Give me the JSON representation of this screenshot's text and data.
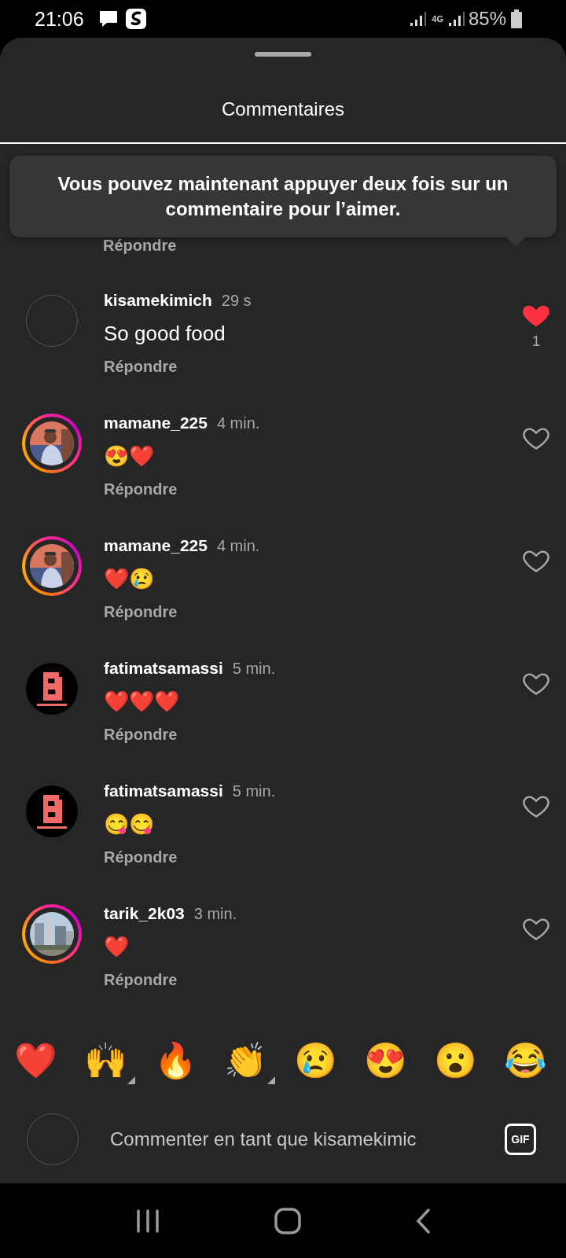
{
  "status_bar": {
    "time": "21:06",
    "network": "4G",
    "battery": "85%"
  },
  "sheet": {
    "title": "Commentaires"
  },
  "tooltip": {
    "text": "Vous pouvez maintenant appuyer deux fois sur un commentaire pour l’aimer."
  },
  "partial_reply": "Répondre",
  "comments": [
    {
      "username": "kisamekimich",
      "time": "29 s",
      "text": "So good food",
      "reply": "Répondre",
      "avatar": {
        "kind": "empty",
        "story_ring": false
      },
      "liked": true,
      "like_count": "1"
    },
    {
      "username": "mamane_225",
      "time": "4 min.",
      "text": "😍❤️",
      "reply": "Répondre",
      "avatar": {
        "kind": "picture",
        "story_ring": true
      },
      "liked": false
    },
    {
      "username": "mamane_225",
      "time": "4 min.",
      "text": "❤️😢",
      "reply": "Répondre",
      "avatar": {
        "kind": "picture",
        "story_ring": true
      },
      "liked": false
    },
    {
      "username": "fatimatsamassi",
      "time": "5 min.",
      "text": "❤️❤️❤️",
      "reply": "Répondre",
      "avatar": {
        "kind": "picture",
        "story_ring": false
      },
      "liked": false
    },
    {
      "username": "fatimatsamassi",
      "time": "5 min.",
      "text": "😋😋",
      "reply": "Répondre",
      "avatar": {
        "kind": "picture",
        "story_ring": false
      },
      "liked": false
    },
    {
      "username": "tarik_2k03",
      "time": "3 min.",
      "text": "❤️",
      "reply": "Répondre",
      "avatar": {
        "kind": "picture",
        "story_ring": true
      },
      "liked": false
    }
  ],
  "reactions": [
    {
      "emoji": "❤️",
      "has_variants": false
    },
    {
      "emoji": "🙌",
      "has_variants": true
    },
    {
      "emoji": "🔥",
      "has_variants": false
    },
    {
      "emoji": "👏",
      "has_variants": true
    },
    {
      "emoji": "😢",
      "has_variants": false
    },
    {
      "emoji": "😍",
      "has_variants": false
    },
    {
      "emoji": "😮",
      "has_variants": false
    },
    {
      "emoji": "😂",
      "has_variants": false
    }
  ],
  "composer": {
    "placeholder": "Commenter en tant que kisamekimic",
    "gif_label": "GIF"
  }
}
